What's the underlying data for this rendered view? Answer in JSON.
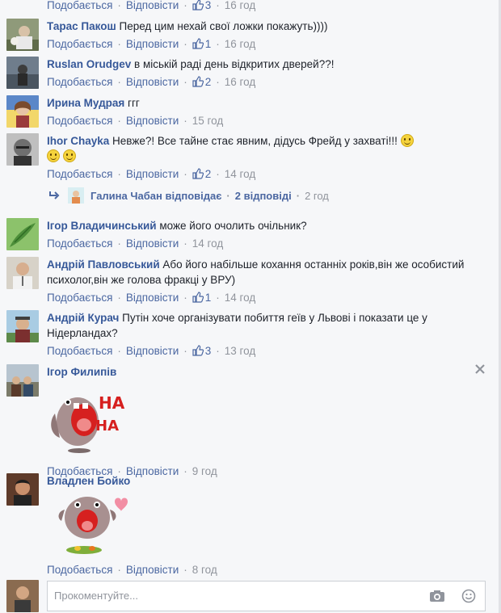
{
  "actions": {
    "like": "Подобається",
    "reply": "Відповісти",
    "sep": "·"
  },
  "comments": [
    {
      "author": "",
      "text": "",
      "likes": "3",
      "time": "16 год"
    },
    {
      "author": "Тарас Пакош",
      "text": "Перед цим нехай свої ложки покажуть))))",
      "likes": "1",
      "time": "16 год"
    },
    {
      "author": "Ruslan Orudgev",
      "text": "в міській раді день відкритих дверей??!",
      "likes": "2",
      "time": "16 год"
    },
    {
      "author": "Ирина Мудрая",
      "text": "ггг",
      "likes": "",
      "time": "15 год"
    },
    {
      "author": "Ihor Chayka",
      "text": "Невже?! Все тайне стає явним, дідусь Фрейд у захваті!!!",
      "likes": "2",
      "time": "14 год"
    },
    {
      "author": "Ігор Владичинський",
      "text": "може його очолить очільник?",
      "likes": "",
      "time": "14 год"
    },
    {
      "author": "Андрій Павловський",
      "text": "Або його набільше кохання останніх років,він же особистий психолог,він же голова фракці у ВРУ)",
      "likes": "1",
      "time": "14 год"
    },
    {
      "author": "Андрій Курач",
      "text": "Путін хоче організувати побиття геїв у Львові і показати це у Нідерландах?",
      "likes": "3",
      "time": "13 год"
    },
    {
      "author": "Ігор Филипів",
      "text": "",
      "likes": "",
      "time": "9 год",
      "sticker_text": [
        "HA",
        "HA"
      ]
    },
    {
      "author": "Владлен Бойко",
      "text": "",
      "likes": "",
      "time": "8 год"
    }
  ],
  "reply_summary": {
    "author": "Галина Чабан",
    "verb": "відповідає",
    "count": "2 відповіді",
    "time": "2 год"
  },
  "composer": {
    "placeholder": "Прокоментуйте..."
  },
  "icons": {
    "thumb": "thumbs-up-icon",
    "reply_arrow": "reply-arrow-icon",
    "camera": "camera-icon",
    "emoji": "emoji-icon",
    "close": "close-icon"
  },
  "colors": {
    "link": "#4b67a1",
    "author": "#365899",
    "muted": "#90949c",
    "background": "#f6f7f9"
  }
}
